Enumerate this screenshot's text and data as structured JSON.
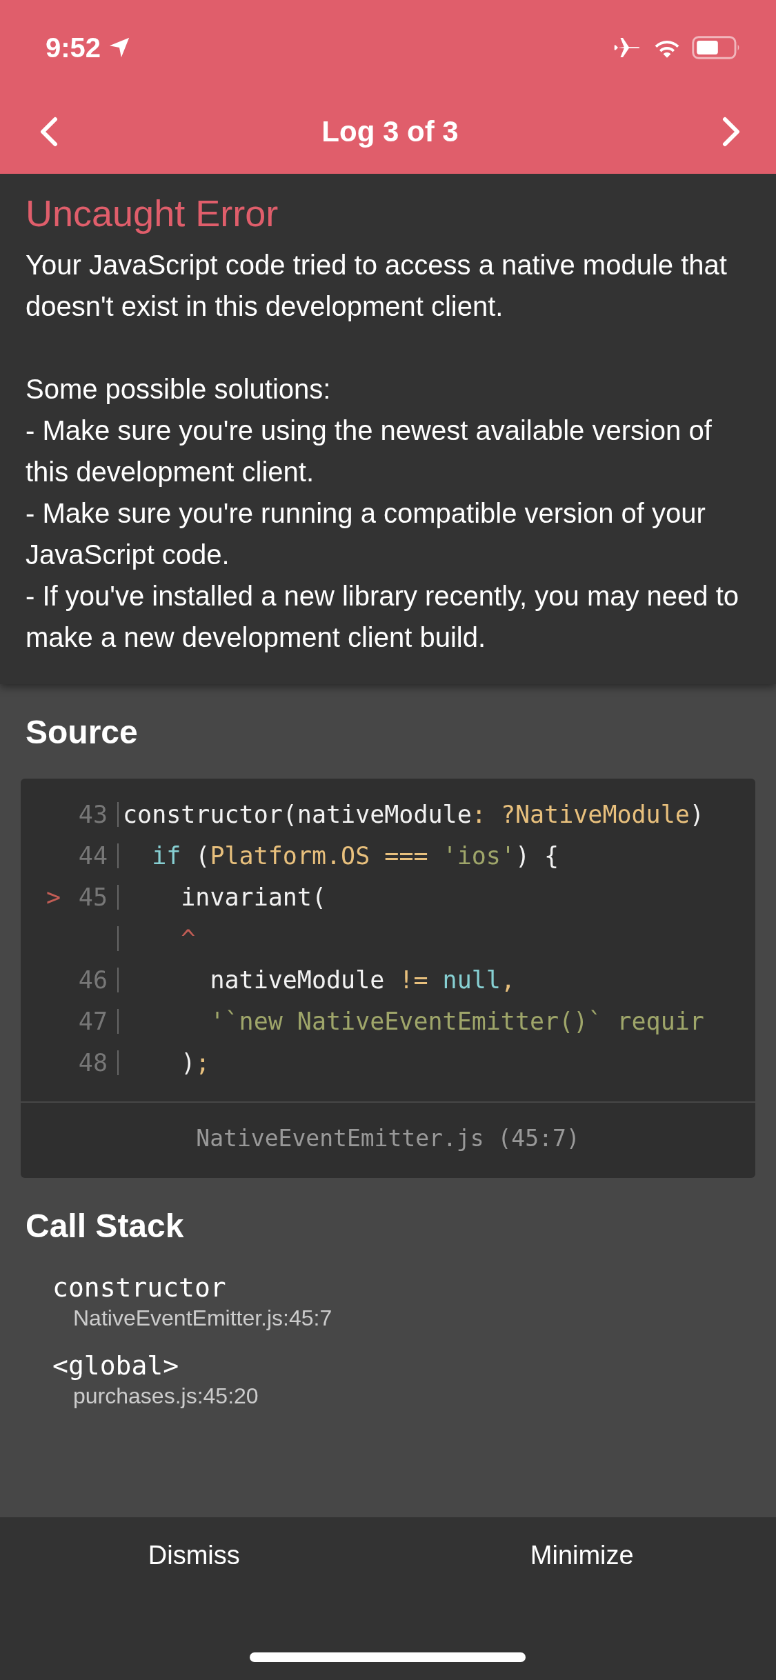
{
  "status_bar": {
    "time": "9:52"
  },
  "nav": {
    "title": "Log 3 of 3"
  },
  "error": {
    "title": "Uncaught Error",
    "message": "Your JavaScript code tried to access a native module that doesn't exist in this development client.",
    "solutions_heading": "Some possible solutions:",
    "solutions": [
      "- Make sure you're using the newest available version of this development client.",
      "- Make sure you're running a compatible version of your JavaScript code.",
      "- If you've installed a new library recently, you may need to make a new development client build."
    ]
  },
  "source": {
    "heading": "Source",
    "lines": [
      {
        "number": "43",
        "tokens": [
          {
            "text": "constructor(nativeModule",
            "kind": "plain"
          },
          {
            "text": ": ?NativeModule",
            "kind": "type"
          },
          {
            "text": ")",
            "kind": "plain"
          }
        ]
      },
      {
        "number": "44",
        "tokens": [
          {
            "text": "  if",
            "kind": "keyword"
          },
          {
            "text": " (",
            "kind": "plain"
          },
          {
            "text": "Platform.OS ===",
            "kind": "type"
          },
          {
            "text": " 'ios'",
            "kind": "string"
          },
          {
            "text": ") {",
            "kind": "plain"
          }
        ]
      },
      {
        "number": "45",
        "marker": ">",
        "tokens": [
          {
            "text": "    invariant(",
            "kind": "plain"
          }
        ]
      },
      {
        "tokens": [
          {
            "text": "    ^",
            "kind": "caret"
          }
        ]
      },
      {
        "number": "46",
        "tokens": [
          {
            "text": "      nativeModule ",
            "kind": "plain"
          },
          {
            "text": "!=",
            "kind": "type"
          },
          {
            "text": " null",
            "kind": "keyword"
          },
          {
            "text": ",",
            "kind": "type"
          }
        ]
      },
      {
        "number": "47",
        "tokens": [
          {
            "text": "      '`new NativeEventEmitter()` requir",
            "kind": "string"
          }
        ]
      },
      {
        "number": "48",
        "tokens": [
          {
            "text": "    )",
            "kind": "plain"
          },
          {
            "text": ";",
            "kind": "type"
          }
        ]
      }
    ],
    "file": "NativeEventEmitter.js (45:7)"
  },
  "call_stack": {
    "heading": "Call Stack",
    "frames": [
      {
        "name": "constructor",
        "location": "NativeEventEmitter.js:45:7"
      },
      {
        "name": "<global>",
        "location": "purchases.js:45:20"
      }
    ]
  },
  "footer": {
    "buttons": [
      "Dismiss",
      "Minimize"
    ]
  }
}
